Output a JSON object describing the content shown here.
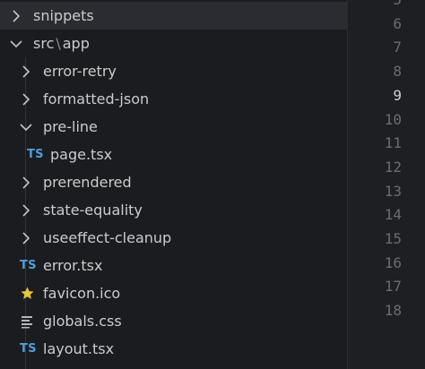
{
  "explorer": {
    "items": [
      {
        "type": "folder",
        "expanded": false,
        "level": 0,
        "label": "snippets",
        "selected": true
      },
      {
        "type": "folder-path",
        "expanded": true,
        "level": 0,
        "parts": [
          "src",
          "\\",
          "app"
        ]
      },
      {
        "type": "folder",
        "expanded": false,
        "level": 1,
        "label": "error-retry"
      },
      {
        "type": "folder",
        "expanded": false,
        "level": 1,
        "label": "formatted-json"
      },
      {
        "type": "folder",
        "expanded": true,
        "level": 1,
        "label": "pre-line"
      },
      {
        "type": "file",
        "icon": "ts",
        "icon_text": "TS",
        "level": 2,
        "label": "page.tsx"
      },
      {
        "type": "folder",
        "expanded": false,
        "level": 1,
        "label": "prerendered"
      },
      {
        "type": "folder",
        "expanded": false,
        "level": 1,
        "label": "state-equality"
      },
      {
        "type": "folder",
        "expanded": false,
        "level": 1,
        "label": "useeffect-cleanup"
      },
      {
        "type": "file",
        "icon": "ts",
        "icon_text": "TS",
        "level": 1,
        "label": "error.tsx"
      },
      {
        "type": "file",
        "icon": "star",
        "level": 1,
        "label": "favicon.ico"
      },
      {
        "type": "file",
        "icon": "lines",
        "level": 1,
        "label": "globals.css"
      },
      {
        "type": "file",
        "icon": "ts",
        "icon_text": "TS",
        "level": 1,
        "label": "layout.tsx"
      }
    ]
  },
  "editor": {
    "line_numbers": [
      "5",
      "6",
      "7",
      "8",
      "9",
      "10",
      "11",
      "12",
      "13",
      "14",
      "15",
      "16",
      "17",
      "18"
    ],
    "active_line": "9"
  },
  "colors": {
    "ts_icon": "#4f9fd9",
    "star_icon": "#e8c53a",
    "css_icon": "#b8b8b8",
    "text": "#cccccc"
  }
}
